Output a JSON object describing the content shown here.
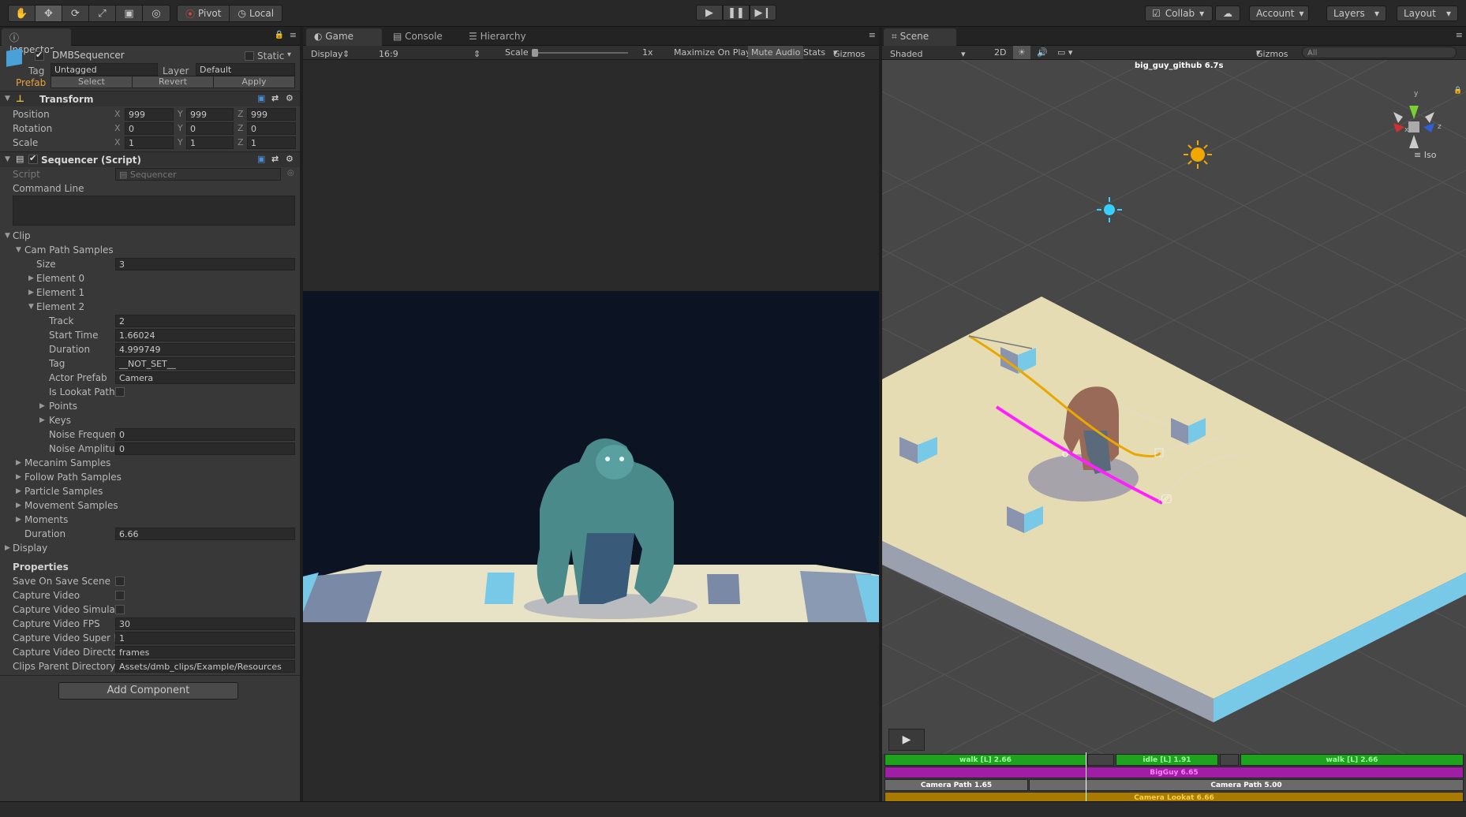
{
  "toolbar": {
    "tools": [
      "hand-tool",
      "move-tool",
      "rotate-tool",
      "scale-tool",
      "rect-tool",
      "transform-tool"
    ],
    "pivot": "Pivot",
    "local": "Local",
    "collab": "Collab",
    "account": "Account",
    "layers": "Layers",
    "layout": "Layout"
  },
  "inspector": {
    "tab": "Inspector",
    "object_name": "DMBSequencer",
    "static_label": "Static",
    "tag_label": "Tag",
    "tag_value": "Untagged",
    "layer_label": "Layer",
    "layer_value": "Default",
    "prefab_label": "Prefab",
    "prefab_select": "Select",
    "prefab_revert": "Revert",
    "prefab_apply": "Apply",
    "transform_title": "Transform",
    "position_label": "Position",
    "pos_x": "999",
    "pos_y": "999",
    "pos_z": "999",
    "rotation_label": "Rotation",
    "rot_x": "0",
    "rot_y": "0",
    "rot_z": "0",
    "scale_label": "Scale",
    "sc_x": "1",
    "sc_y": "1",
    "sc_z": "1",
    "x": "X",
    "y": "Y",
    "z": "Z",
    "script_title": "Sequencer (Script)",
    "script_label": "Script",
    "script_value": "Sequencer",
    "command_line": "Command Line",
    "clip": "Clip",
    "cam_path": "Cam Path Samples",
    "size_label": "Size",
    "size_value": "3",
    "el0": "Element 0",
    "el1": "Element 1",
    "el2": "Element 2",
    "track_label": "Track",
    "track_value": "2",
    "start_label": "Start Time",
    "start_value": "1.66024",
    "duration_label": "Duration",
    "duration_value": "4.999749",
    "tag2_label": "Tag",
    "tag2_value": "__NOT_SET__",
    "actor_label": "Actor Prefab",
    "actor_value": "Camera",
    "lookat_label": "Is Lookat Path",
    "points": "Points",
    "keys": "Keys",
    "noise_freq_label": "Noise Frequen",
    "noise_freq_value": "0",
    "noise_amp_label": "Noise Amplituc",
    "noise_amp_value": "0",
    "mecanim": "Mecanim Samples",
    "follow": "Follow Path Samples",
    "particle": "Particle Samples",
    "movement": "Movement Samples",
    "moments": "Moments",
    "clip_dur_label": "Duration",
    "clip_dur_value": "6.66",
    "display": "Display",
    "properties": "Properties",
    "save_scene": "Save On Save Scene",
    "capture_video": "Capture Video",
    "capture_sim": "Capture Video Simulat",
    "fps_label": "Capture Video FPS",
    "fps_value": "30",
    "super_label": "Capture Video Super !",
    "super_value": "1",
    "dir_label": "Capture Video Directo",
    "dir_value": "frames",
    "clips_label": "Clips Parent Directory",
    "clips_value": "Assets/dmb_clips/Example/Resources",
    "add_component": "Add Component"
  },
  "game": {
    "tabs": [
      "Game",
      "Console",
      "Hierarchy"
    ],
    "display": "Display 1",
    "aspect": "16:9",
    "scale": "Scale",
    "scale_val": "1x",
    "maximize": "Maximize On Play",
    "mute": "Mute Audio",
    "stats": "Stats",
    "gizmos": "Gizmos"
  },
  "scene": {
    "tab": "Scene",
    "shaded": "Shaded",
    "mode2d": "2D",
    "gizmos": "Gizmos",
    "search_placeholder": "All",
    "title": "big_guy_github 6.7s",
    "iso": "Iso",
    "axis_x": "x",
    "axis_y": "y",
    "axis_z": "z"
  },
  "timeline": {
    "tracks": [
      {
        "label": "walk [L] 2.66",
        "color": "#1ea31e"
      },
      {
        "label": "idle [L] 1.91",
        "color": "#1ea31e"
      },
      {
        "label": "walk [L] 2.66",
        "color": "#1ea31e"
      },
      {
        "label": "BigGuy 6.65",
        "color": "#a01ea5"
      },
      {
        "label": "Camera Path 1.65",
        "color": "#6a6a6a"
      },
      {
        "label": "Camera Path 5.00",
        "color": "#6a6a6a"
      },
      {
        "label": "Camera Lookat 6.66",
        "color": "#a87a00"
      }
    ]
  }
}
